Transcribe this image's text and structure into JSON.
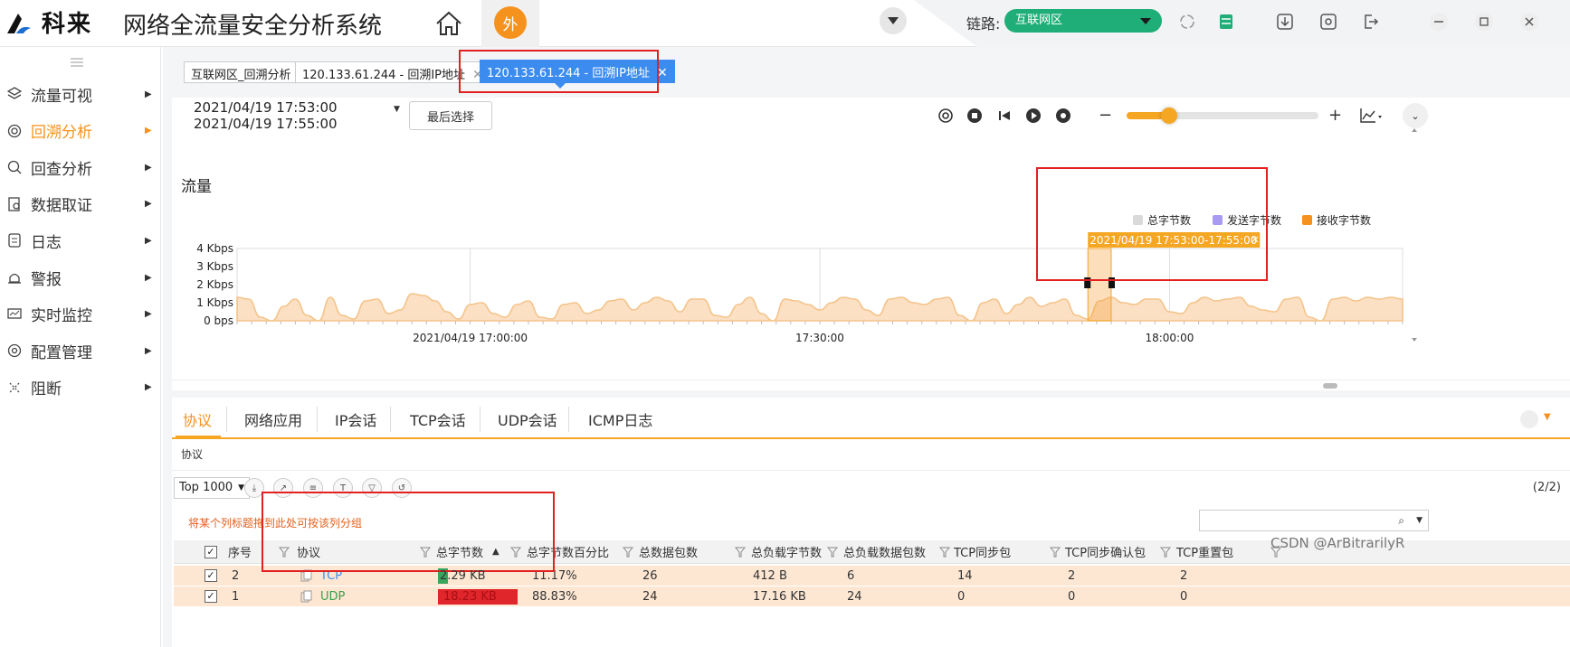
{
  "topbar": {
    "brand": "科来",
    "app_title": "网络全流量安全分析系统",
    "ext_button": "外",
    "link_label": "链路:",
    "link_value": "互联网区"
  },
  "sidebar": {
    "items": [
      {
        "label": "流量可视",
        "icon": "layers-icon",
        "active": false
      },
      {
        "label": "回溯分析",
        "icon": "backtrace-icon",
        "active": true
      },
      {
        "label": "回查分析",
        "icon": "search-icon",
        "active": false
      },
      {
        "label": "数据取证",
        "icon": "evidence-icon",
        "active": false
      },
      {
        "label": "日志",
        "icon": "log-icon",
        "active": false
      },
      {
        "label": "警报",
        "icon": "alarm-icon",
        "active": false
      },
      {
        "label": "实时监控",
        "icon": "monitor-icon",
        "active": false
      },
      {
        "label": "配置管理",
        "icon": "gear-icon",
        "active": false
      },
      {
        "label": "阻断",
        "icon": "block-icon",
        "active": false
      }
    ]
  },
  "page_tabs": [
    {
      "label": "互联网区_回溯分析",
      "closable": false
    },
    {
      "label": "120.133.61.244 - 回溯IP地址",
      "closable": true
    },
    {
      "label": "120.133.61.244 - 回溯IP地址",
      "closable": true,
      "active": true
    }
  ],
  "controls": {
    "time_start": "2021/04/19 17:53:00",
    "time_end": "2021/04/19 17:55:00",
    "last_select": "最后选择",
    "zoom_minus": "−",
    "zoom_plus": "+",
    "zoom_level": 0.22
  },
  "chart_data": {
    "type": "area",
    "title": "流量",
    "legend": [
      {
        "name": "总字节数",
        "color": "#d9d9d9"
      },
      {
        "name": "发送字节数",
        "color": "#a99cf0"
      },
      {
        "name": "接收字节数",
        "color": "#f5921e"
      }
    ],
    "legend_position": "top-right",
    "y_ticks": [
      "4 Kbps",
      "3 Kbps",
      "2 Kbps",
      "1 Kbps",
      "0 bps"
    ],
    "x_ticks": [
      "2021/04/19 17:00:00",
      "17:30:00",
      "18:00:00"
    ],
    "ylim": [
      0,
      4
    ],
    "y_unit": "Kbps",
    "x_start_minutes_from_1640": 0,
    "x_end_minutes_from_1640": 100,
    "selection_label": "2021/04/19 17:53:00-17:55:00",
    "selection_start_min": 73,
    "selection_end_min": 75,
    "series": [
      {
        "name": "总字节数",
        "color": "#f5c389",
        "values": [
          1.3,
          1.2,
          0.2,
          0.0,
          0.8,
          1.2,
          0.3,
          0.0,
          1.3,
          0.3,
          0.1,
          1.1,
          1.2,
          0.4,
          0.6,
          1.5,
          1.4,
          1.1,
          0.5,
          0.1,
          0.9,
          1.0,
          0.4,
          0.2,
          0.9,
          1.1,
          0.2,
          0.1,
          0.9,
          1.0,
          0.4,
          0.6,
          1.1,
          1.2,
          0.6,
          1.0,
          1.3,
          1.1,
          0.5,
          1.2,
          1.2,
          0.3,
          0.2,
          0.9,
          1.3,
          0.4,
          0.0,
          1.2,
          1.1,
          0.9,
          0.6,
          1.0,
          1.3,
          1.2,
          0.6,
          0.3,
          1.2,
          1.3,
          1.0,
          0.9,
          1.2,
          1.3,
          0.3,
          0.0,
          1.0,
          1.2,
          0.4,
          0.9,
          1.3,
          0.8,
          1.0,
          1.2,
          0.3,
          0.1,
          1.1,
          1.3,
          1.0,
          0.9,
          1.2,
          1.2,
          0.5,
          0.4,
          1.0,
          1.3,
          1.1,
          1.2,
          1.3,
          0.8,
          0.6,
          0.5,
          1.2,
          1.3,
          0.2,
          0.0,
          1.2,
          1.3,
          1.1,
          1.3,
          1.2,
          1.3,
          1.2
        ]
      }
    ]
  },
  "detail_tabs": [
    "协议",
    "网络应用",
    "IP会话",
    "TCP会话",
    "UDP会话",
    "ICMP日志"
  ],
  "sub_label": "协议",
  "toolbar": {
    "topn": "Top 1000",
    "page_count": "(2/2)"
  },
  "group_hint": "将某个列标题拖到此处可按该列分组",
  "table": {
    "columns": [
      "序号",
      "协议",
      "总字节数",
      "总字节数百分比",
      "总数据包数",
      "总负载字节数",
      "总负载数据包数",
      "TCP同步包",
      "TCP同步确认包",
      "TCP重置包"
    ],
    "rows": [
      {
        "no": "2",
        "protocol": "TCP",
        "bytes": "2.29 KB",
        "bytes_pct": "11.17%",
        "bytes_frac": 0.1117,
        "packets": "26",
        "payload_bytes": "412 B",
        "payload_packets": "6",
        "syn": "14",
        "synack": "2",
        "rst": "2"
      },
      {
        "no": "1",
        "protocol": "UDP",
        "bytes": "18.23 KB",
        "bytes_pct": "88.83%",
        "bytes_frac": 0.8883,
        "packets": "24",
        "payload_bytes": "17.16 KB",
        "payload_packets": "24",
        "syn": "0",
        "synack": "0",
        "rst": "0"
      }
    ]
  },
  "watermark": "CSDN @ArBitrarilyR",
  "colors": {
    "accent": "#f5921e",
    "link_green": "#1fae78",
    "tab_blue": "#3c8cf0",
    "highlight_red": "#e1211f",
    "row_bg": "#fde7d3"
  }
}
